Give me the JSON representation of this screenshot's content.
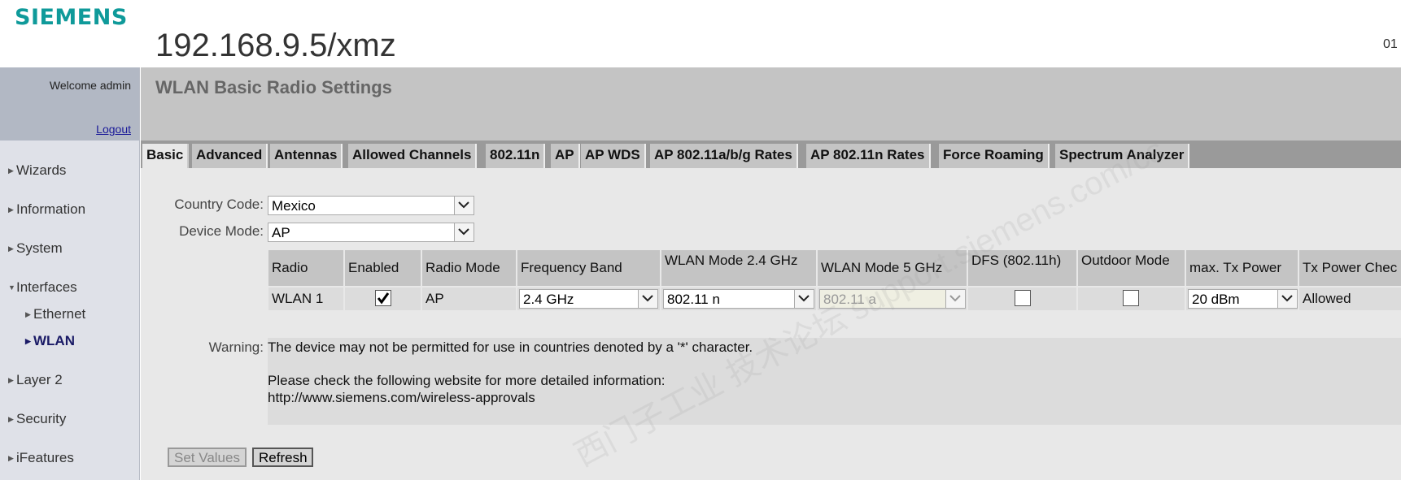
{
  "header": {
    "logo": "SIEMENS",
    "device_title": "192.168.9.5/xmz",
    "corner_text": "01"
  },
  "sidebar": {
    "welcome": "Welcome admin",
    "logout": "Logout",
    "items": [
      {
        "label": "Wizards"
      },
      {
        "label": "Information"
      },
      {
        "label": "System"
      },
      {
        "label": "Interfaces"
      },
      {
        "label": "Ethernet"
      },
      {
        "label": "WLAN"
      },
      {
        "label": "Layer 2"
      },
      {
        "label": "Security"
      },
      {
        "label": "iFeatures"
      }
    ]
  },
  "page": {
    "title": "WLAN Basic Radio Settings"
  },
  "tabs": [
    {
      "label": "Basic"
    },
    {
      "label": "Advanced"
    },
    {
      "label": "Antennas"
    },
    {
      "label": "Allowed Channels"
    },
    {
      "label": "802.11n"
    },
    {
      "label": "AP"
    },
    {
      "label": "AP WDS"
    },
    {
      "label": "AP 802.11a/b/g Rates"
    },
    {
      "label": "AP 802.11n Rates"
    },
    {
      "label": "Force Roaming"
    },
    {
      "label": "Spectrum Analyzer"
    }
  ],
  "form": {
    "country_code_label": "Country Code:",
    "country_code_value": "Mexico",
    "device_mode_label": "Device Mode:",
    "device_mode_value": "AP"
  },
  "table": {
    "headers": [
      "Radio",
      "Enabled",
      "Radio Mode",
      "Frequency Band",
      "WLAN Mode 2.4 GHz",
      "WLAN Mode 5 GHz",
      "DFS (802.11h)",
      "Outdoor Mode",
      "max. Tx Power",
      "Tx Power Chec"
    ],
    "row": {
      "radio": "WLAN 1",
      "enabled": true,
      "radio_mode": "AP",
      "frequency_band": "2.4 GHz",
      "wlan_mode_24": "802.11 n",
      "wlan_mode_5": "802.11 a",
      "dfs": false,
      "outdoor": false,
      "max_tx_power": "20 dBm",
      "tx_power_check": "Allowed"
    }
  },
  "warning": {
    "label": "Warning:",
    "line1": "The device may not be permitted for use in countries denoted by a '*' character.",
    "line2": "Please check the following website for more detailed information:",
    "line3": "http://www.siemens.com/wireless-approvals"
  },
  "buttons": {
    "set_values": "Set Values",
    "refresh": "Refresh"
  },
  "watermark": "西门子工业 技术论坛 support.siemens.com/cs",
  "colors": {
    "brand": "#0f9a9a",
    "page_head": "#c4c4c4",
    "tabbar": "#9a9a9a",
    "sidebar": "#dfe1e8"
  }
}
